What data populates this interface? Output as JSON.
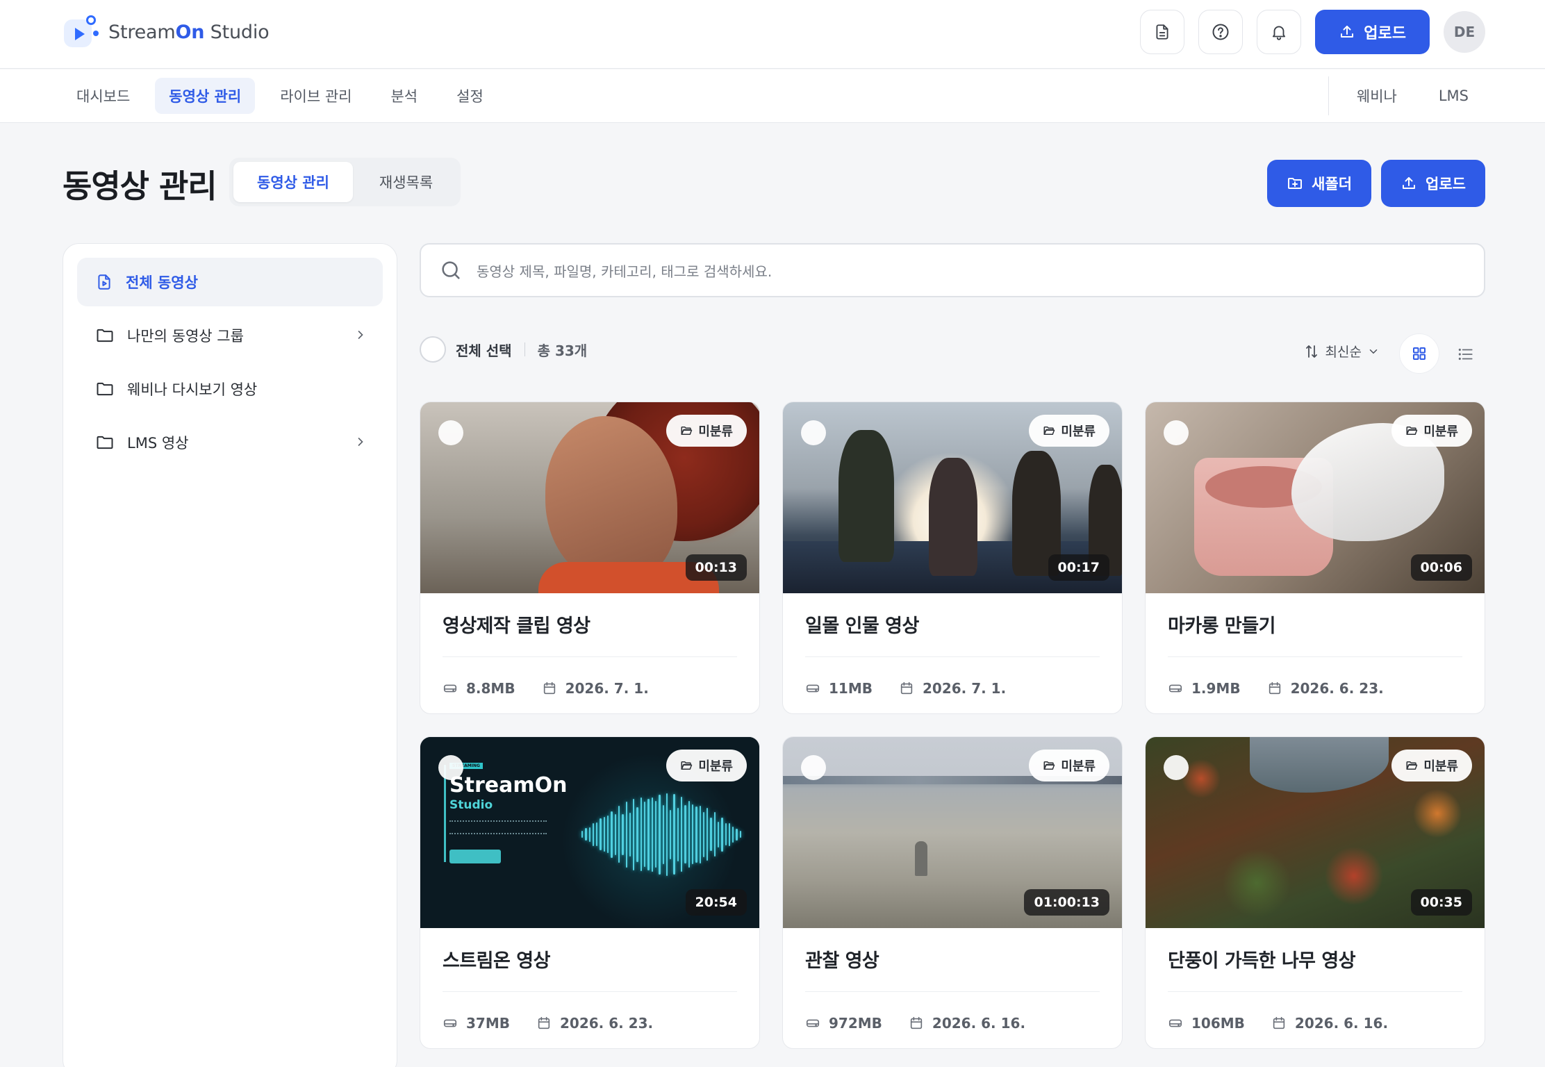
{
  "header": {
    "logo_prefix": "Stream",
    "logo_accent": "On",
    "logo_suffix": " Studio",
    "upload_label": "업로드",
    "avatar_initials": "DE"
  },
  "nav": {
    "items": [
      "대시보드",
      "동영상 관리",
      "라이브 관리",
      "분석",
      "설정"
    ],
    "active_index": 1,
    "right_items": [
      "웨비나",
      "LMS"
    ]
  },
  "page": {
    "title": "동영상 관리",
    "tabs": [
      "동영상 관리",
      "재생목록"
    ],
    "new_folder_label": "새폴더",
    "upload_label": "업로드"
  },
  "sidebar": {
    "items": [
      {
        "label": "전체 동영상",
        "icon": "file-video-icon",
        "active": true,
        "has_chevron": false
      },
      {
        "label": "나만의 동영상 그룹",
        "icon": "folder-icon",
        "active": false,
        "has_chevron": true
      },
      {
        "label": "웨비나 다시보기 영상",
        "icon": "folder-icon",
        "active": false,
        "has_chevron": false
      },
      {
        "label": "LMS 영상",
        "icon": "folder-icon",
        "active": false,
        "has_chevron": true
      }
    ]
  },
  "search": {
    "placeholder": "동영상 제목, 파일명, 카테고리, 태그로 검색하세요."
  },
  "toolbar": {
    "select_all": "전체 선택",
    "count": "총 33개",
    "sort": "최신순"
  },
  "videos": [
    {
      "title": "영상제작 클립 영상",
      "size": "8.8MB",
      "date": "2026. 7. 1.",
      "duration": "00:13",
      "category": "미분류"
    },
    {
      "title": "일몰 인물 영상",
      "size": "11MB",
      "date": "2026. 7. 1.",
      "duration": "00:17",
      "category": "미분류"
    },
    {
      "title": "마카롱 만들기",
      "size": "1.9MB",
      "date": "2026. 6. 23.",
      "duration": "00:06",
      "category": "미분류"
    },
    {
      "title": "스트림온 영상",
      "size": "37MB",
      "date": "2026. 6. 23.",
      "duration": "20:54",
      "category": "미분류"
    },
    {
      "title": "관찰 영상",
      "size": "972MB",
      "date": "2026. 6. 16.",
      "duration": "01:00:13",
      "category": "미분류"
    },
    {
      "title": "단풍이 가득한 나무 영상",
      "size": "106MB",
      "date": "2026. 6. 16.",
      "duration": "00:35",
      "category": "미분류"
    }
  ],
  "thumb4": {
    "tag": "STREAMING",
    "brand": "StreamOn",
    "brand_sub": "Studio"
  },
  "colors": {
    "accent": "#2f5be7",
    "background": "#f5f6f8"
  }
}
